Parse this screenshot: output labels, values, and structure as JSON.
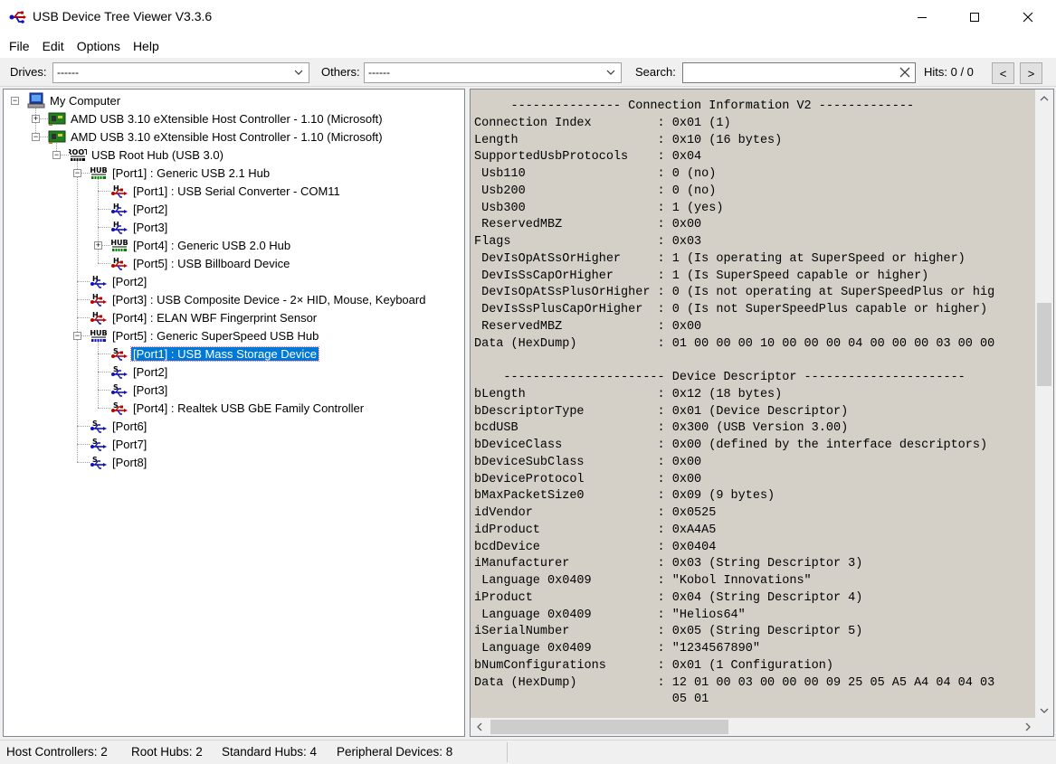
{
  "window": {
    "title": "USB Device Tree Viewer V3.3.6",
    "minimize_icon": "minimize-icon",
    "maximize_icon": "maximize-icon",
    "close_icon": "close-icon"
  },
  "menu": [
    "File",
    "Edit",
    "Options",
    "Help"
  ],
  "toolbar": {
    "drives_label": "Drives:",
    "drives_value": "------",
    "others_label": "Others:",
    "others_value": "------",
    "search_label": "Search:",
    "search_value": "",
    "hits": "Hits: 0 / 0",
    "prev_label": "<",
    "next_label": ">"
  },
  "tree": [
    {
      "label": "My Computer",
      "icon": "computer-icon",
      "depth": 0,
      "expander": "minus"
    },
    {
      "label": "AMD USB 3.10 eXtensible Host Controller - 1.10 (Microsoft)",
      "icon": "host-controller-icon",
      "depth": 1,
      "expander": "plus"
    },
    {
      "label": "AMD USB 3.10 eXtensible Host Controller - 1.10 (Microsoft)",
      "icon": "host-controller-icon",
      "depth": 1,
      "expander": "minus"
    },
    {
      "label": "USB Root Hub (USB 3.0)",
      "icon": "root-hub-icon",
      "icon_text": "ROOT",
      "depth": 2,
      "expander": "minus"
    },
    {
      "label": "[Port1] : Generic USB 2.1 Hub",
      "icon": "hub-icon",
      "icon_text": "HUB",
      "icon_color": "#008000",
      "depth": 3,
      "expander": "minus"
    },
    {
      "label": "[Port1] : USB Serial Converter - COM11",
      "icon": "usb-device-icon",
      "icon_text": "H",
      "icon_color": "#c00000",
      "depth": 4
    },
    {
      "label": "[Port2]",
      "icon": "usb-port-icon",
      "icon_text": "H",
      "icon_color": "#1010c0",
      "depth": 4
    },
    {
      "label": "[Port3]",
      "icon": "usb-port-icon",
      "icon_text": "H",
      "icon_color": "#1010c0",
      "depth": 4
    },
    {
      "label": "[Port4] : Generic USB 2.0 Hub",
      "icon": "hub-icon",
      "icon_text": "HUB",
      "icon_color": "#008000",
      "depth": 4,
      "expander": "plus"
    },
    {
      "label": "[Port5] : USB Billboard Device",
      "icon": "usb-device-icon",
      "icon_text": "H",
      "icon_color": "#c00000",
      "depth": 4
    },
    {
      "label": "[Port2]",
      "icon": "usb-port-icon",
      "icon_text": "H",
      "icon_color": "#1010c0",
      "depth": 3
    },
    {
      "label": "[Port3] : USB Composite Device - 2× HID, Mouse, Keyboard",
      "icon": "usb-device-icon",
      "icon_text": "H",
      "icon_color": "#c00000",
      "depth": 3
    },
    {
      "label": "[Port4] : ELAN WBF Fingerprint Sensor",
      "icon": "usb-device-icon",
      "icon_text": "H",
      "icon_color": "#c00000",
      "depth": 3
    },
    {
      "label": "[Port5] : Generic SuperSpeed USB Hub",
      "icon": "hub-icon",
      "icon_text": "HUB",
      "icon_color": "#1010c0",
      "depth": 3,
      "expander": "minus"
    },
    {
      "label": "[Port1] : USB Mass Storage Device",
      "icon": "usb-device-icon",
      "icon_text": "S",
      "icon_color": "#c00000",
      "depth": 4,
      "selected": true
    },
    {
      "label": "[Port2]",
      "icon": "usb-port-icon",
      "icon_text": "S",
      "icon_color": "#1010c0",
      "depth": 4
    },
    {
      "label": "[Port3]",
      "icon": "usb-port-icon",
      "icon_text": "S",
      "icon_color": "#1010c0",
      "depth": 4
    },
    {
      "label": "[Port4] : Realtek USB GbE Family Controller",
      "icon": "usb-device-icon",
      "icon_text": "S",
      "icon_color": "#c00000",
      "depth": 4
    },
    {
      "label": "[Port6]",
      "icon": "usb-port-icon",
      "icon_text": "S",
      "icon_color": "#1010c0",
      "depth": 3
    },
    {
      "label": "[Port7]",
      "icon": "usb-port-icon",
      "icon_text": "S",
      "icon_color": "#1010c0",
      "depth": 3
    },
    {
      "label": "[Port8]",
      "icon": "usb-port-icon",
      "icon_text": "S",
      "icon_color": "#1010c0",
      "depth": 3
    }
  ],
  "details": [
    "     --------------- Connection Information V2 -------------",
    "Connection Index         : 0x01 (1)",
    "Length                   : 0x10 (16 bytes)",
    "SupportedUsbProtocols    : 0x04",
    " Usb110                  : 0 (no)",
    " Usb200                  : 0 (no)",
    " Usb300                  : 1 (yes)",
    " ReservedMBZ             : 0x00",
    "Flags                    : 0x03",
    " DevIsOpAtSsOrHigher     : 1 (Is operating at SuperSpeed or higher)",
    " DevIsSsCapOrHigher      : 1 (Is SuperSpeed capable or higher)",
    " DevIsOpAtSsPlusOrHigher : 0 (Is not operating at SuperSpeedPlus or hig",
    " DevIsSsPlusCapOrHigher  : 0 (Is not SuperSpeedPlus capable or higher)",
    " ReservedMBZ             : 0x00",
    "Data (HexDump)           : 01 00 00 00 10 00 00 00 04 00 00 00 03 00 00",
    "",
    "    ---------------------- Device Descriptor ----------------------",
    "bLength                  : 0x12 (18 bytes)",
    "bDescriptorType          : 0x01 (Device Descriptor)",
    "bcdUSB                   : 0x300 (USB Version 3.00)",
    "bDeviceClass             : 0x00 (defined by the interface descriptors)",
    "bDeviceSubClass          : 0x00",
    "bDeviceProtocol          : 0x00",
    "bMaxPacketSize0          : 0x09 (9 bytes)",
    "idVendor                 : 0x0525",
    "idProduct                : 0xA4A5",
    "bcdDevice                : 0x0404",
    "iManufacturer            : 0x03 (String Descriptor 3)",
    " Language 0x0409         : \"Kobol Innovations\"",
    "iProduct                 : 0x04 (String Descriptor 4)",
    " Language 0x0409         : \"Helios64\"",
    "iSerialNumber            : 0x05 (String Descriptor 5)",
    " Language 0x0409         : \"1234567890\"",
    "bNumConfigurations       : 0x01 (1 Configuration)",
    "Data (HexDump)           : 12 01 00 03 00 00 00 09 25 05 A5 A4 04 04 03",
    "                           05 01"
  ],
  "status": {
    "host_controllers": "Host Controllers: 2",
    "root_hubs": "Root Hubs: 2",
    "standard_hubs": "Standard Hubs: 4",
    "peripheral_devices": "Peripheral Devices: 8"
  },
  "colors": {
    "selection": "#0078d7",
    "detail_background": "#d4d0c8",
    "hub_green": "#008000",
    "usb_red": "#c00000",
    "usb_blue": "#1010c0"
  }
}
